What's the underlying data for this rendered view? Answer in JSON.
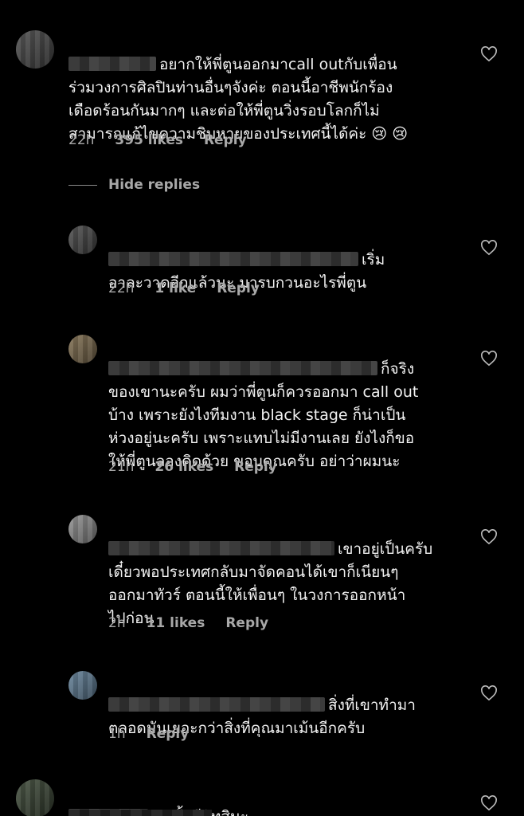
{
  "comments": [
    {
      "text": "อยากให้พี่ตูนออกมาcall outกับเพื่อน\nร่วมวงการศิลปินท่านอื่นๆจังค่ะ ตอนนี้อาชีพนักร้อง\nเดือดร้อนกันมากๆ และต่อให้พี่ตูนวิ่งรอบโลกก็ไม่\nสามารถแก้ไขความชิบหายของประเทศนี้ได้ค่ะ 😢 😢",
      "time": "22h",
      "likes": "395 likes",
      "reply": "Reply"
    }
  ],
  "hide_replies": "Hide replies",
  "replies": [
    {
      "text": "เริ่ม\nอาละวาดอีกแล้วนะ มารบกวนอะไรพี่ตูน",
      "time": "22h",
      "likes": "1 like",
      "reply": "Reply"
    },
    {
      "text": "ก็จริง\nของเขานะครับ ผมว่าพี่ตูนก็ควรออกมา call out\nบ้าง เพราะยังไงทีมงาน black stage ก็น่าเป็น\nห่วงอยู่นะครับ เพราะแทบไม่มีงานเลย ยังไงก็ขอ\nให้พี่ตูนลองคิดด้วย ขอบคุณครับ อย่าว่าผมนะ",
      "time": "21h",
      "likes": "26 likes",
      "reply": "Reply"
    },
    {
      "text": "เขาอยู่เป็นครับ\nเดี๋ยวพอประเทศกลับมาจัดคอนได้เขาก็เนียนๆ\nออกมาทัวร์ ตอนนี้ให้เพื่อนๆ ในวงการออกหน้า\nไปก่อน",
      "time": "2h",
      "likes": "11 likes",
      "reply": "Reply"
    },
    {
      "text": "สิ่งที่เขาทำมา\nตลอดมันเยอะกว่าสิ่งที่คุณมาเม้นอีกครับ",
      "time": "1h",
      "reply": "Reply"
    }
  ],
  "last_comment": {
    "text": "ชนชั้นอีลิทสินะ"
  },
  "colors": {
    "background": "#000000",
    "text": "#f2f2f2",
    "meta": "#a8a8a8"
  },
  "icons": {
    "like": "heart-outline-icon"
  }
}
